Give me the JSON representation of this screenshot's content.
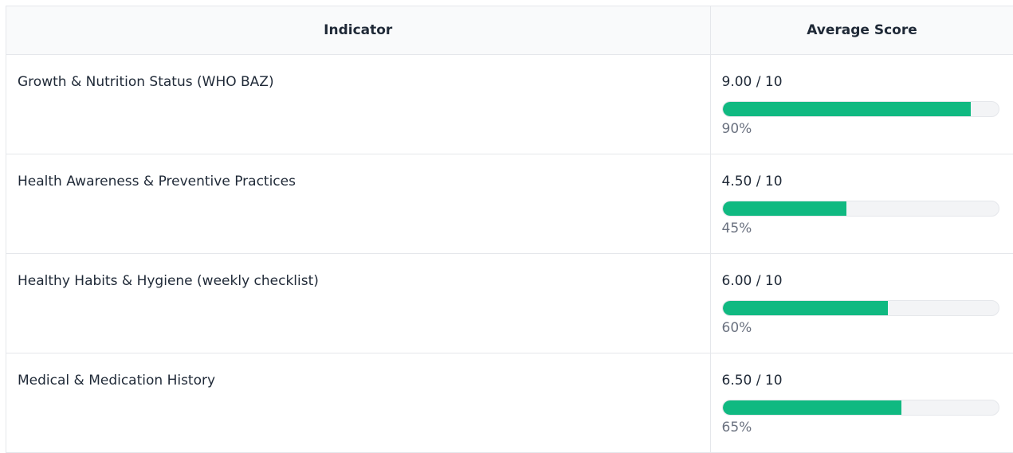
{
  "table": {
    "headers": {
      "indicator": "Indicator",
      "average_score": "Average Score"
    },
    "rows": [
      {
        "indicator": "Growth & Nutrition Status (WHO BAZ)",
        "score": "9.00 / 10",
        "percent_label": "90%",
        "percent": 90
      },
      {
        "indicator": "Health Awareness & Preventive Practices",
        "score": "4.50 / 10",
        "percent_label": "45%",
        "percent": 45
      },
      {
        "indicator": "Healthy Habits & Hygiene (weekly checklist)",
        "score": "6.00 / 10",
        "percent_label": "60%",
        "percent": 60
      },
      {
        "indicator": "Medical & Medication History",
        "score": "6.50 / 10",
        "percent_label": "65%",
        "percent": 65
      }
    ]
  },
  "colors": {
    "bar_fill": "#10b981",
    "bar_track": "#f3f4f6",
    "header_bg": "#f9fafb",
    "border": "#e5e7eb",
    "muted_text": "#6b7280"
  }
}
